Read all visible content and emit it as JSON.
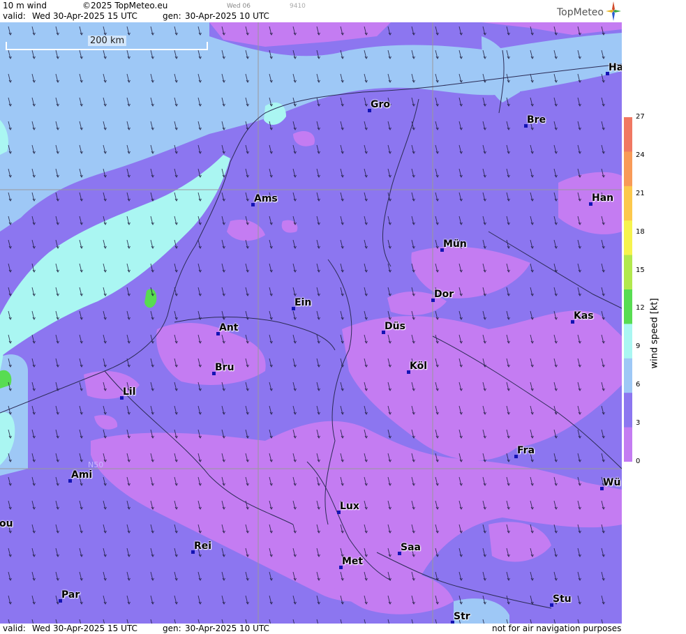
{
  "header": {
    "product": "10 m wind",
    "copyright": "©2025 TopMeteo.eu",
    "valid_label": "valid:",
    "valid_time": "Wed  30-Apr-2025  15 UTC",
    "gen_label": "gen:",
    "gen_time": "30-Apr-2025 10 UTC",
    "frame_day": "Wed 06",
    "frame_code": "9410",
    "brand": "TopMeteo"
  },
  "footer": {
    "valid_label": "valid:",
    "valid_time": "Wed  30-Apr-2025  15 UTC",
    "gen_label": "gen:",
    "gen_time": "30-Apr-2025 10 UTC",
    "disclaimer": "not for air navigation purposes"
  },
  "scale_bar": {
    "label": "200 km"
  },
  "graticule": {
    "lat_label": "N50"
  },
  "cities": [
    {
      "name": "Ha"
    },
    {
      "name": "Gro"
    },
    {
      "name": "Bre"
    },
    {
      "name": "Ams"
    },
    {
      "name": "Han"
    },
    {
      "name": "Mün"
    },
    {
      "name": "Ein"
    },
    {
      "name": "Dor"
    },
    {
      "name": "Kas"
    },
    {
      "name": "Ant"
    },
    {
      "name": "Düs"
    },
    {
      "name": "Bru"
    },
    {
      "name": "Köl"
    },
    {
      "name": "Lil"
    },
    {
      "name": "Fra"
    },
    {
      "name": "Ami"
    },
    {
      "name": "Wü"
    },
    {
      "name": "Lux"
    },
    {
      "name": "ou"
    },
    {
      "name": "Rei"
    },
    {
      "name": "Saa"
    },
    {
      "name": "Met"
    },
    {
      "name": "Par"
    },
    {
      "name": "Stu"
    },
    {
      "name": "Str"
    }
  ],
  "legend": {
    "title": "wind speed  [kt]",
    "ticks": [
      "27",
      "24",
      "21",
      "18",
      "15",
      "12",
      "9",
      "6",
      "3",
      "0"
    ],
    "colors": [
      "#f07862",
      "#f89a58",
      "#fcc84c",
      "#f6f34e",
      "#b2e84e",
      "#58dc52",
      "#aaf6f2",
      "#9ec8f6",
      "#8c76f0",
      "#c47cf2"
    ]
  },
  "map_colors": {
    "calm": "#c47cf2",
    "light": "#8c76f0",
    "moderate": "#9ec8f6",
    "fresh": "#aaf6f2",
    "strong": "#58dc52",
    "water": "#7fa0f0"
  }
}
